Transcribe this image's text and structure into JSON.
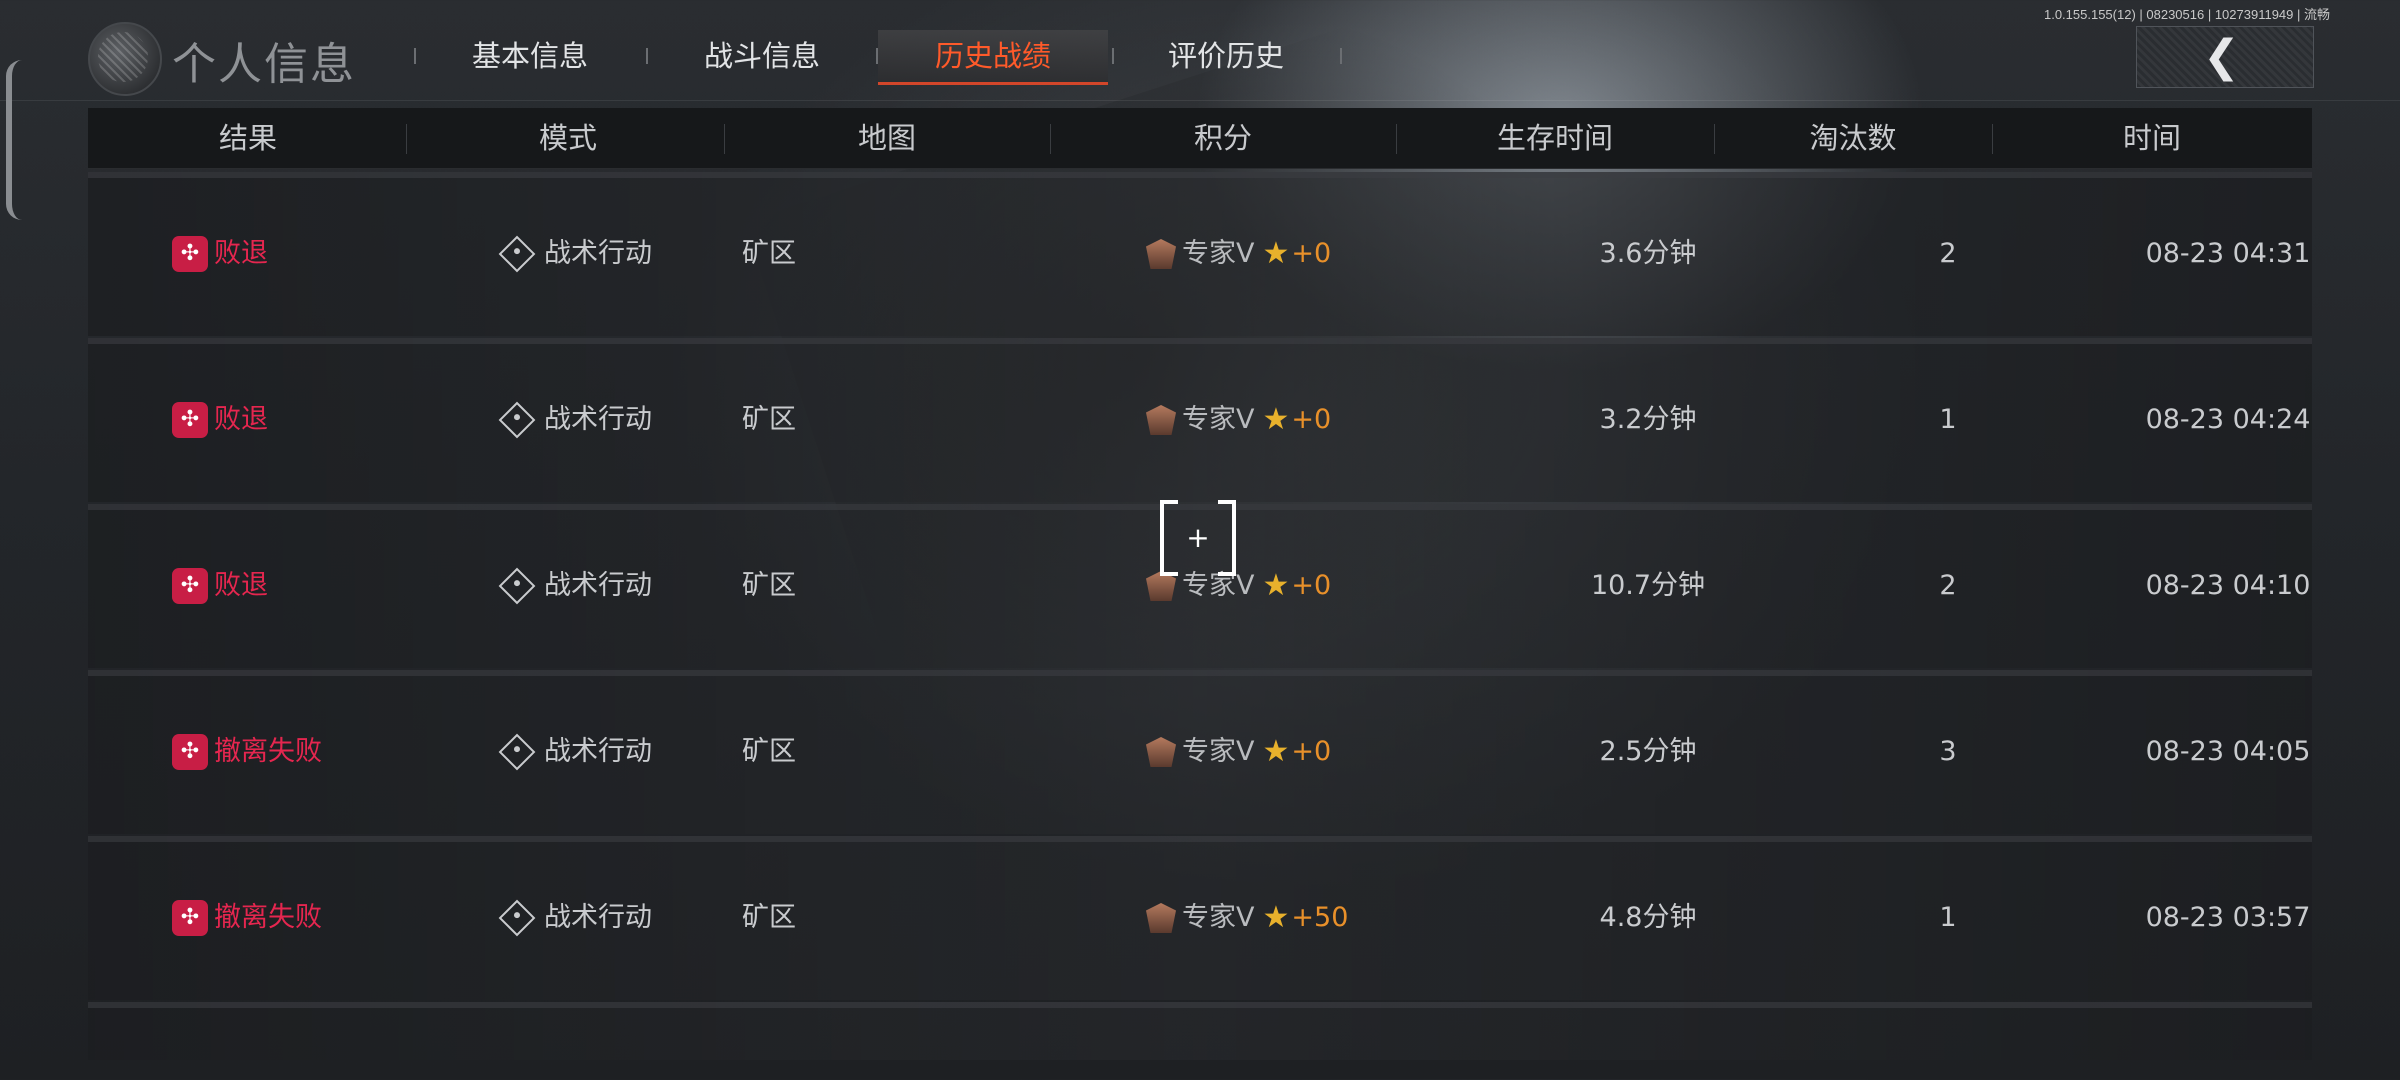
{
  "header": {
    "title": "个人信息",
    "tabs": [
      {
        "label": "基本信息",
        "active": false
      },
      {
        "label": "战斗信息",
        "active": false
      },
      {
        "label": "历史战绩",
        "active": true
      },
      {
        "label": "评价历史",
        "active": false
      }
    ],
    "system_info": "1.0.155.155(12) | 08230516 | 10273911949 | 流畅",
    "back_icon": "chevron-left-icon"
  },
  "table": {
    "columns": [
      "结果",
      "模式",
      "地图",
      "积分",
      "生存时间",
      "淘汰数",
      "时间"
    ],
    "rows": [
      {
        "result": "败退",
        "mode": "战术行动",
        "map": "矿区",
        "rank": "专家V",
        "points": "+0",
        "survival": "3.6分钟",
        "eliminations": "2",
        "time": "08-23 04:31"
      },
      {
        "result": "败退",
        "mode": "战术行动",
        "map": "矿区",
        "rank": "专家V",
        "points": "+0",
        "survival": "3.2分钟",
        "eliminations": "1",
        "time": "08-23 04:24"
      },
      {
        "result": "败退",
        "mode": "战术行动",
        "map": "矿区",
        "rank": "专家V",
        "points": "+0",
        "survival": "10.7分钟",
        "eliminations": "2",
        "time": "08-23 04:10"
      },
      {
        "result": "撤离失败",
        "mode": "战术行动",
        "map": "矿区",
        "rank": "专家V",
        "points": "+0",
        "survival": "2.5分钟",
        "eliminations": "3",
        "time": "08-23 04:05"
      },
      {
        "result": "撤离失败",
        "mode": "战术行动",
        "map": "矿区",
        "rank": "专家V",
        "points": "+50",
        "survival": "4.8分钟",
        "eliminations": "1",
        "time": "08-23 03:57"
      }
    ]
  },
  "crosshair": {
    "symbol": "+"
  },
  "colors": {
    "accent": "#ff5a2a",
    "fail": "#e5264f",
    "points": "#e8902a"
  }
}
